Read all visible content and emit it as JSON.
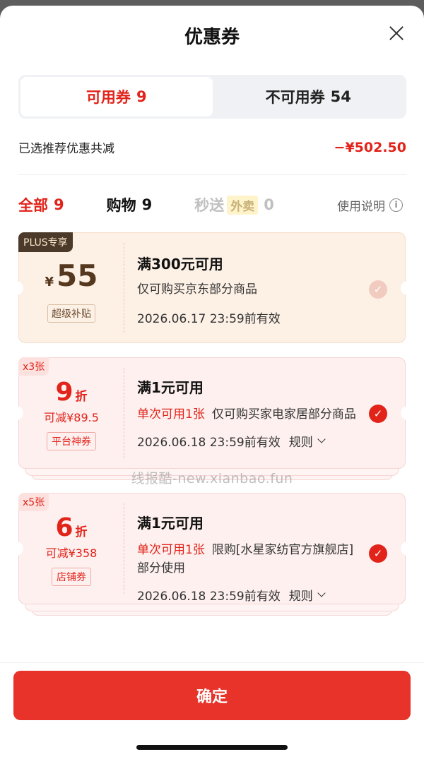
{
  "header": {
    "title": "优惠券"
  },
  "tabs": [
    {
      "label": "可用券",
      "count": "9"
    },
    {
      "label": "不可用券",
      "count": "54"
    }
  ],
  "summary": {
    "label": "已选推荐优惠共减",
    "amount": "−¥502.50"
  },
  "filters": {
    "all": {
      "label": "全部",
      "count": "9"
    },
    "shopping": {
      "label": "购物",
      "count": "9"
    },
    "instant": {
      "label": "秒送",
      "tag": "外卖",
      "count": "0"
    },
    "help": "使用说明",
    "help_icon": "info-icon"
  },
  "coupons": [
    {
      "corner_tag": "PLUS专享",
      "currency": "¥",
      "amount": "55",
      "type_tag": "超级补贴",
      "title": "满300元可用",
      "desc": "仅可购买京东部分商品",
      "expiry": "2026.06.17 23:59前有效",
      "selected": false
    },
    {
      "corner_tag": "x3张",
      "discount": "9",
      "discount_unit": "折",
      "save": "可减¥89.5",
      "type_tag": "平台神券",
      "title": "满1元可用",
      "limit": "单次可用1张",
      "desc": "仅可购买家电家居部分商品",
      "expiry": "2026.06.18 23:59前有效",
      "rules": "规则",
      "selected": true
    },
    {
      "corner_tag": "x5张",
      "discount": "6",
      "discount_unit": "折",
      "save": "可减¥358",
      "type_tag": "店铺券",
      "title": "满1元可用",
      "limit": "单次可用1张",
      "desc": "限购[水星家纺官方旗舰店]部分使用",
      "expiry": "2026.06.18 23:59前有效",
      "rules": "规则",
      "selected": true
    }
  ],
  "watermark": "线报酷-new.xianbao.fun",
  "footer": {
    "confirm_label": "确定"
  },
  "colors": {
    "accent": "#e2231a",
    "plus_bg": "#fdf1e6",
    "coupon_bg": "#fdf0ef"
  }
}
